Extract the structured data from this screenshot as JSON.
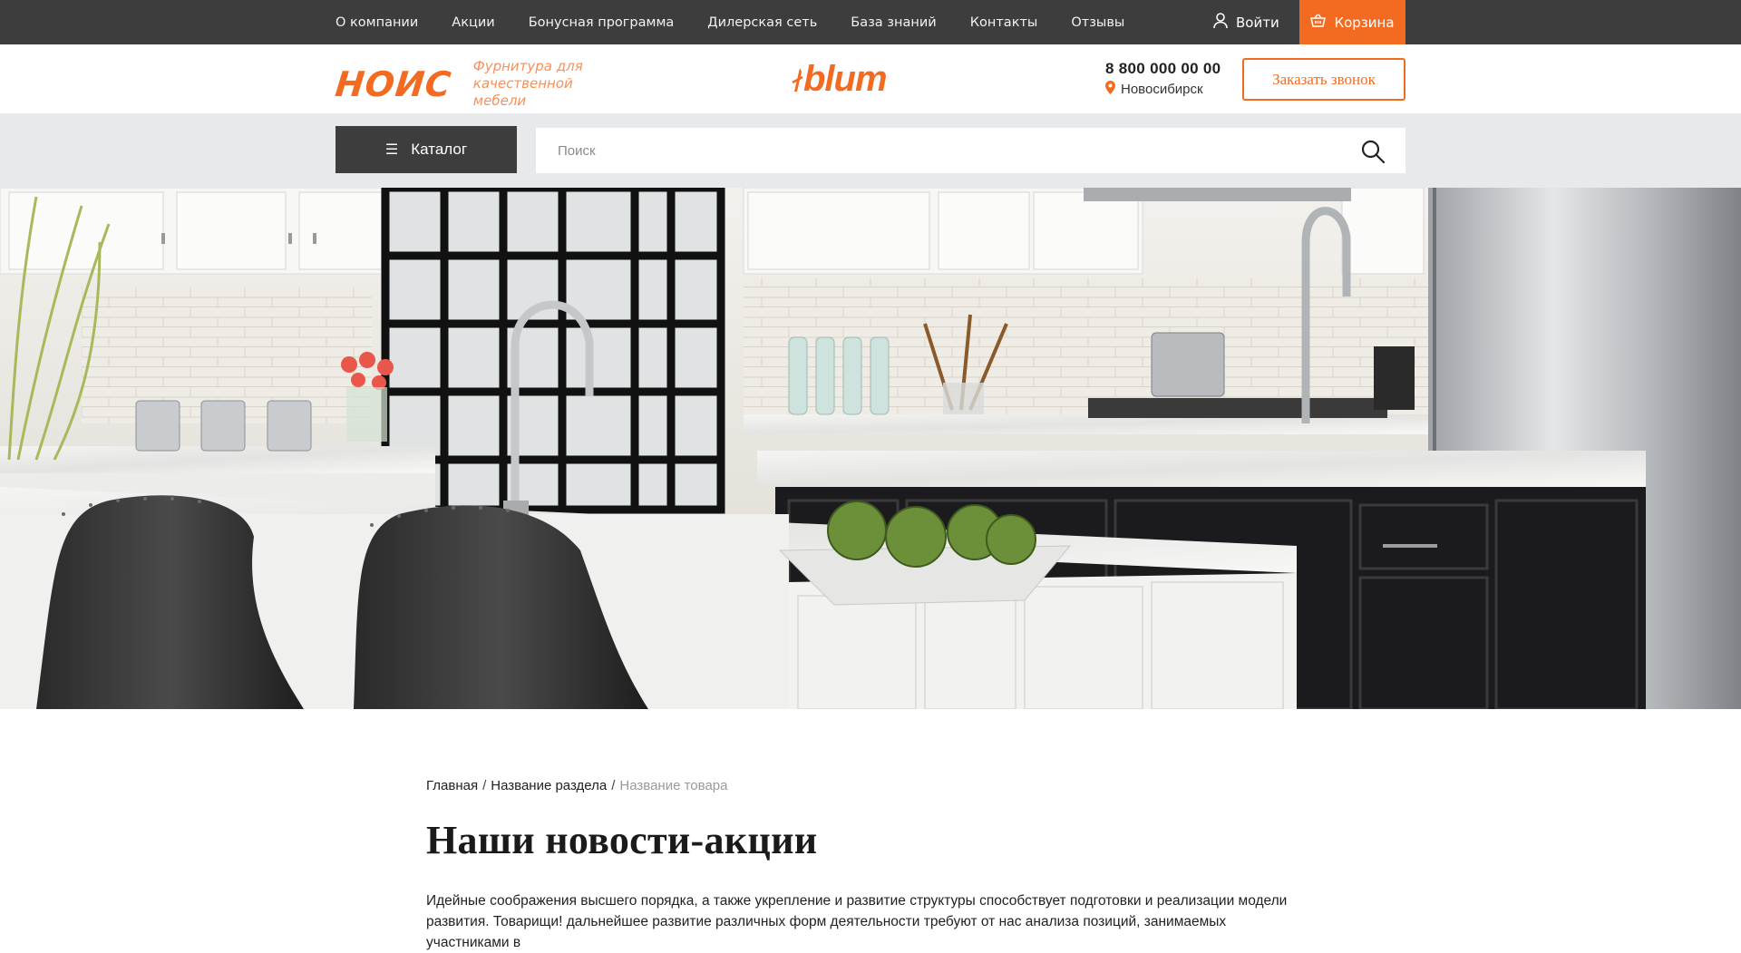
{
  "top_nav": {
    "items": [
      {
        "label": "О компании"
      },
      {
        "label": "Акции"
      },
      {
        "label": "Бонусная программа"
      },
      {
        "label": "Дилерская сеть"
      },
      {
        "label": "База знаний"
      },
      {
        "label": "Контакты"
      },
      {
        "label": "Отзывы"
      }
    ],
    "login_label": "Войти",
    "cart_label": "Корзина"
  },
  "header": {
    "brand_name": "НОИС",
    "brand_tagline": "Фурнитура для качественной мебели",
    "partner_logo": "blum",
    "phone": "8 800 000 00 00",
    "city": "Новосибирск",
    "callback_label": "Заказать звонок"
  },
  "search": {
    "catalog_label": "Каталог",
    "placeholder": "Поиск"
  },
  "breadcrumb": {
    "items": [
      "Главная",
      "Название раздела"
    ],
    "current": "Название товара"
  },
  "page": {
    "title": "Наши новости-акции",
    "lead": "Идейные соображения высшего порядка, а также укрепление и развитие структуры способствует подготовки и реализации модели развития. Товарищи! дальнейшее развитие различных форм деятельности требуют от нас анализа позиций, занимаемых участниками в"
  },
  "colors": {
    "accent": "#f36b21",
    "dark_bar": "#3d3d3d",
    "search_bg": "#e8e9eb"
  },
  "icons": {
    "login": "user-icon",
    "cart": "basket-icon",
    "city": "location-pin-icon",
    "catalog": "hamburger-icon",
    "search": "magnifier-icon"
  }
}
